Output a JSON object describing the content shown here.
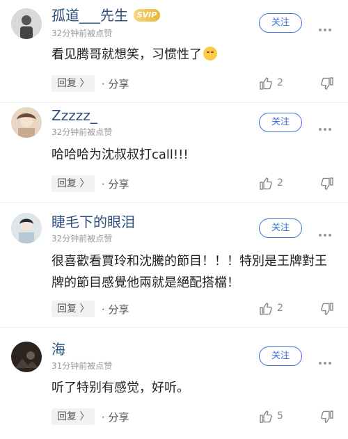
{
  "comments": [
    {
      "username": "孤道___先生",
      "vip_badge": "SVIP",
      "time": "32分钟前被点赞",
      "follow_label": "关注",
      "content": "看见腾哥就想笑，习惯性了",
      "reply_label": "回复 〉",
      "share_label": "· 分享",
      "likes": "2"
    },
    {
      "username": "Zzzzz_",
      "time": "32分钟前被点赞",
      "follow_label": "关注",
      "content": "哈哈哈为沈叔叔打call!!!",
      "reply_label": "回复 〉",
      "share_label": "· 分享",
      "likes": "2"
    },
    {
      "username": "睫毛下的眼泪",
      "time": "32分钟前被点赞",
      "follow_label": "关注",
      "content": "很喜歡看賈玲和沈騰的節目！！！特別是王牌對王牌的節目感覺他兩就是絕配搭檔！",
      "reply_label": "回复 〉",
      "share_label": "· 分享",
      "likes": "2"
    },
    {
      "username": "海",
      "time": "31分钟前被点赞",
      "follow_label": "关注",
      "content": "听了特别有感觉，好听。",
      "reply_label": "回复 〉",
      "share_label": "· 分享",
      "likes": "5"
    }
  ],
  "icons": {
    "like": "thumbs-up-icon",
    "dislike": "thumbs-down-icon",
    "more": "more-dots-icon",
    "emoji": "smirk-emoji-icon"
  },
  "colors": {
    "username": "#2c4f7c",
    "follow": "#3a72d6",
    "vip": "#e8b53a"
  }
}
